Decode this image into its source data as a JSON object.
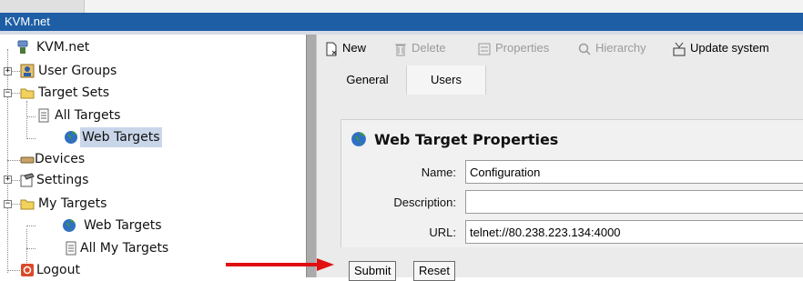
{
  "window": {
    "title": "KVM.net"
  },
  "tree": {
    "root": "KVM.net",
    "items": [
      {
        "label": "User Groups"
      },
      {
        "label": "Target Sets"
      },
      {
        "label": "All Targets"
      },
      {
        "label": "Web Targets"
      },
      {
        "label": "Devices"
      },
      {
        "label": "Settings"
      },
      {
        "label": "My Targets"
      },
      {
        "label": "Web Targets"
      },
      {
        "label": "All My Targets"
      },
      {
        "label": "Logout"
      }
    ]
  },
  "toolbar": {
    "new": "New",
    "delete": "Delete",
    "properties": "Properties",
    "hierarchy": "Hierarchy",
    "update": "Update system"
  },
  "tabs": {
    "general": "General",
    "users": "Users"
  },
  "panel": {
    "title": "Web Target Properties",
    "fields": {
      "name": {
        "label": "Name:",
        "value": "Configuration"
      },
      "description": {
        "label": "Description:",
        "value": ""
      },
      "url": {
        "label": "URL:",
        "value": "telnet://80.238.223.134:4000"
      }
    },
    "submit": "Submit",
    "reset": "Reset"
  },
  "colors": {
    "titlebar": "#1e5ea5",
    "arrow": "#e01010",
    "selection": "#c9d6ea"
  }
}
